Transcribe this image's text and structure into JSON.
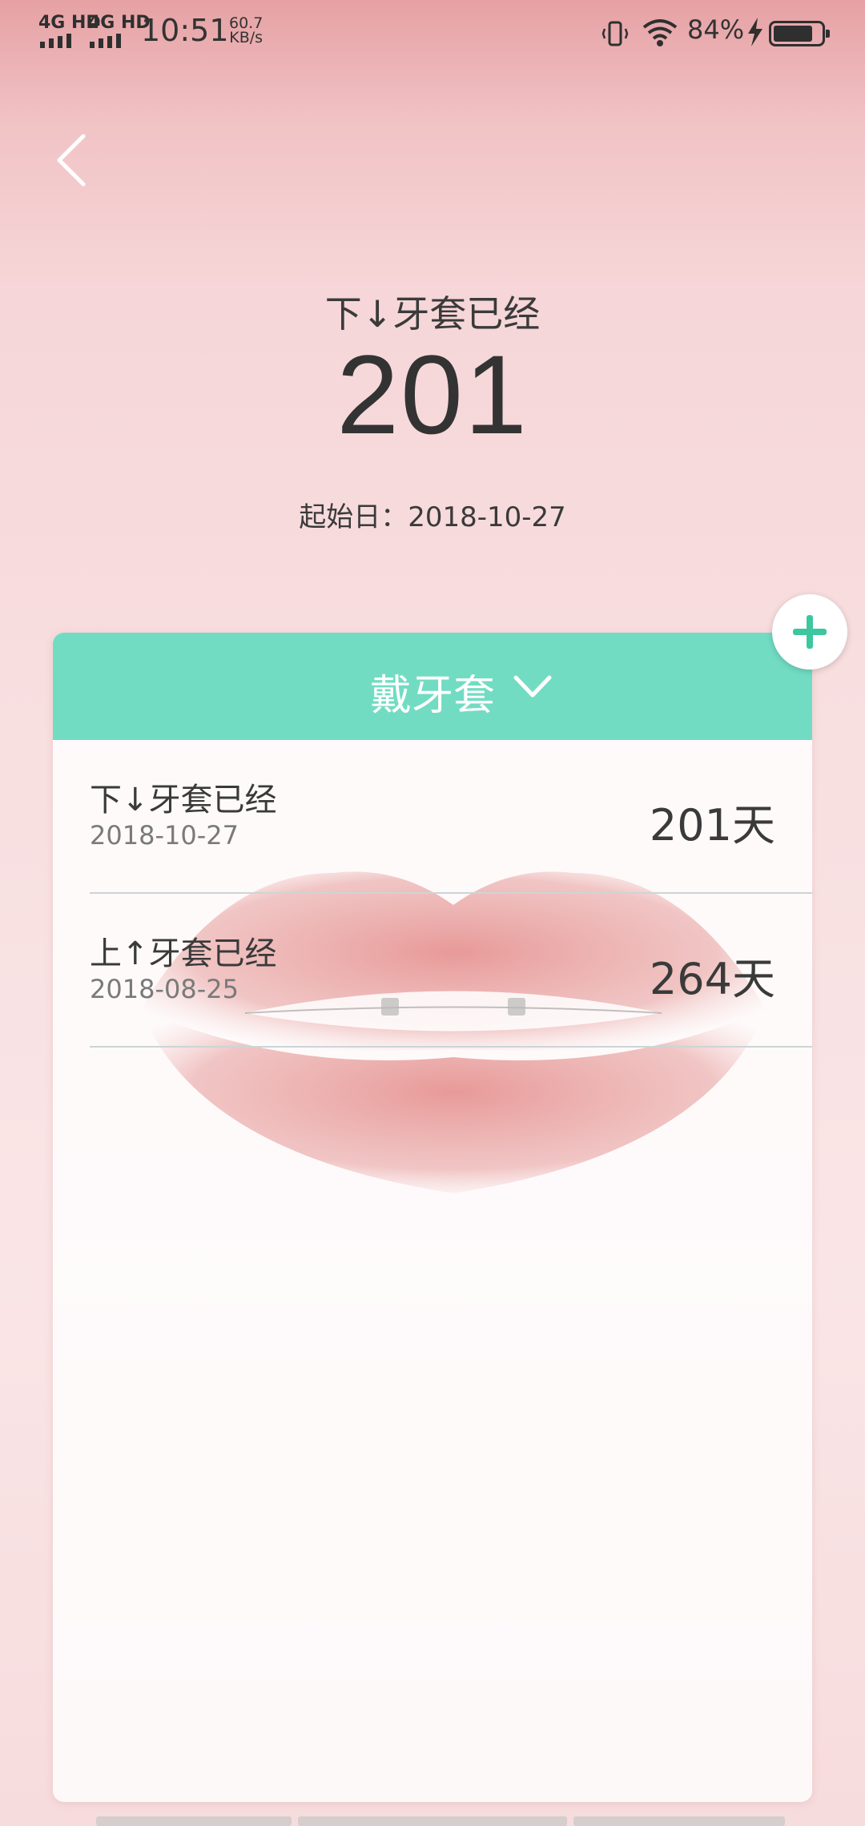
{
  "status_bar": {
    "network1": "4G HD",
    "network2": "4G HD",
    "time": "10:51",
    "speed_value": "60.7",
    "speed_unit": "KB/s",
    "battery_percent": "84%",
    "battery_level": 0.84
  },
  "hero": {
    "label": "下↓牙套已经",
    "count": "201",
    "start_date": "起始日：2018-10-27"
  },
  "card": {
    "title": "戴牙套",
    "accent_color": "#72dcc3",
    "items": [
      {
        "name": "下↓牙套已经",
        "date": "2018-10-27",
        "days": "201天"
      },
      {
        "name": "上↑牙套已经",
        "date": "2018-08-25",
        "days": "264天"
      }
    ]
  },
  "icons": {
    "back": "back-chevron-icon",
    "add": "plus-icon",
    "dropdown": "chevron-down-icon"
  }
}
